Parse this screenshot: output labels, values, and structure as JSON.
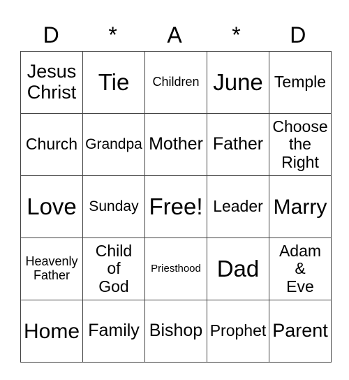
{
  "header": [
    "D",
    "*",
    "A",
    "*",
    "D"
  ],
  "rows": [
    [
      {
        "text": "Jesus\nChrist",
        "size": "s22"
      },
      {
        "text": "Tie",
        "size": "s26"
      },
      {
        "text": "Children",
        "size": "s14"
      },
      {
        "text": "June",
        "size": "s26"
      },
      {
        "text": "Temple",
        "size": "s18"
      }
    ],
    [
      {
        "text": "Church",
        "size": "s18"
      },
      {
        "text": "Grandpa",
        "size": "s16"
      },
      {
        "text": "Mother",
        "size": "s20"
      },
      {
        "text": "Father",
        "size": "s20"
      },
      {
        "text": "Choose\nthe\nRight",
        "size": "s18"
      }
    ],
    [
      {
        "text": "Love",
        "size": "s26"
      },
      {
        "text": "Sunday",
        "size": "s16"
      },
      {
        "text": "Free!",
        "size": "s26"
      },
      {
        "text": "Leader",
        "size": "s18"
      },
      {
        "text": "Marry",
        "size": "s24"
      }
    ],
    [
      {
        "text": "Heavenly\nFather",
        "size": "s14"
      },
      {
        "text": "Child\nof\nGod",
        "size": "s18"
      },
      {
        "text": "Priesthood",
        "size": "s12"
      },
      {
        "text": "Dad",
        "size": "s26"
      },
      {
        "text": "Adam\n&\nEve",
        "size": "s18"
      }
    ],
    [
      {
        "text": "Home",
        "size": "s24"
      },
      {
        "text": "Family",
        "size": "s20"
      },
      {
        "text": "Bishop",
        "size": "s20"
      },
      {
        "text": "Prophet",
        "size": "s18"
      },
      {
        "text": "Parent",
        "size": "s22"
      }
    ]
  ]
}
